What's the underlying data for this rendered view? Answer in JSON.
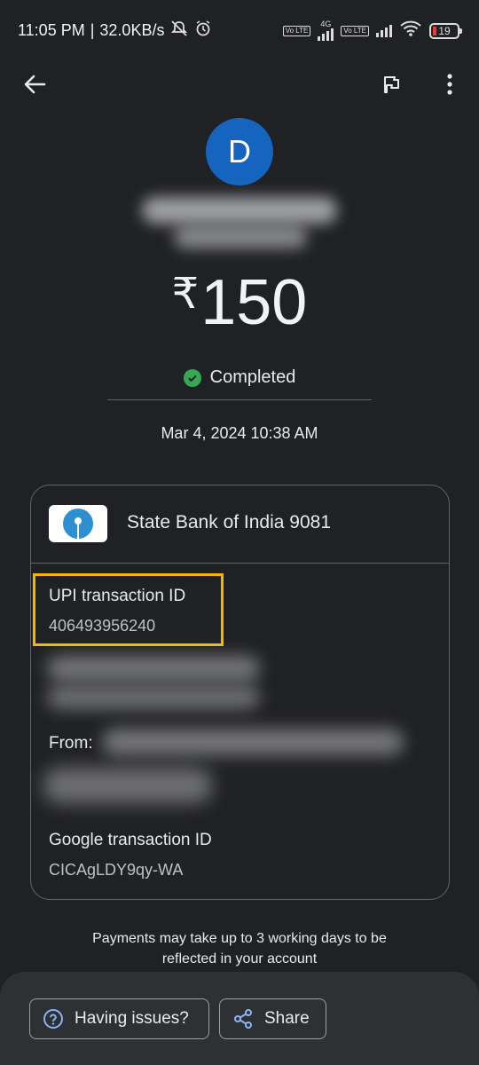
{
  "status_bar": {
    "time": "11:05 PM",
    "speed": "32.0KB/s",
    "network_type": "4G",
    "volte_label": "Vo LTE",
    "battery": "19"
  },
  "payee": {
    "avatar_letter": "D"
  },
  "transaction": {
    "currency_symbol": "₹",
    "amount": "150",
    "status": "Completed",
    "datetime": "Mar 4, 2024 10:38 AM"
  },
  "details": {
    "bank_name": "State Bank of India 9081",
    "upi_label": "UPI transaction ID",
    "upi_id": "406493956240",
    "from_label": "From:",
    "google_label": "Google transaction ID",
    "google_id": "CICAgLDY9qy-WA"
  },
  "note": {
    "line1": "Payments may take up to 3 working days to be",
    "line2": "reflected in your account"
  },
  "actions": {
    "issues_label": "Having issues?",
    "share_label": "Share"
  },
  "colors": {
    "background": "#202124",
    "avatar": "#1565c0",
    "success": "#34a853",
    "highlight": "#f5b800"
  }
}
